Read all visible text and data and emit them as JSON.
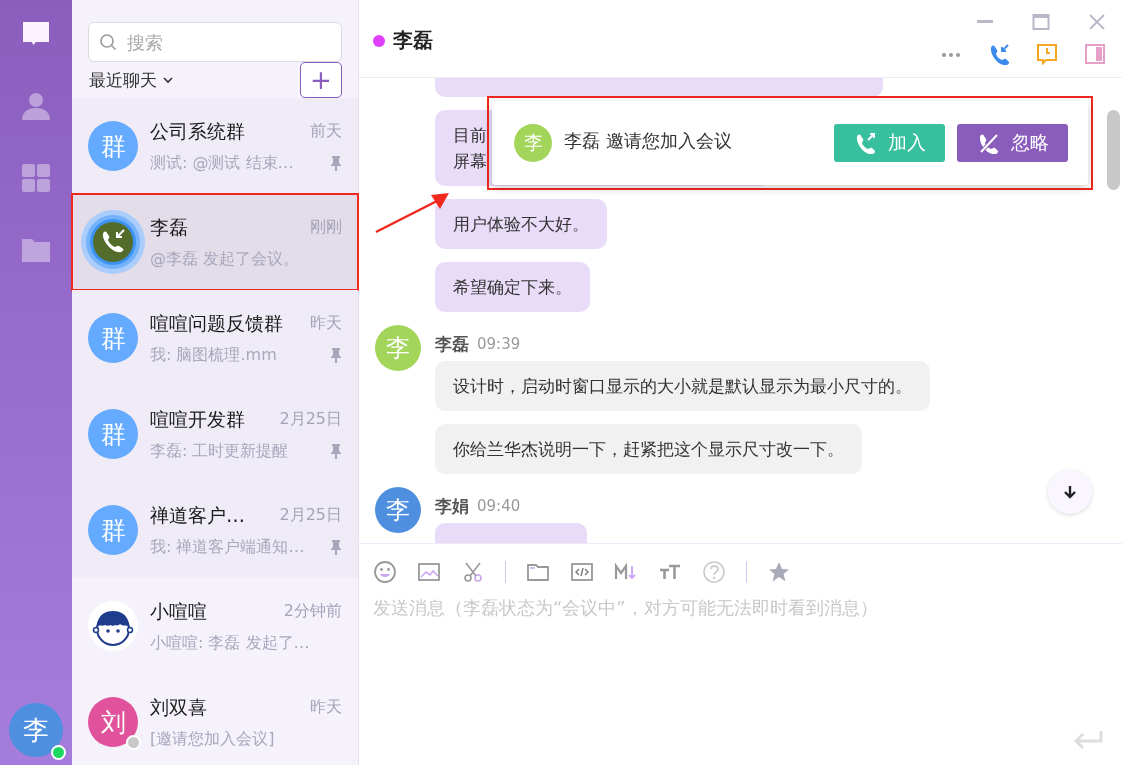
{
  "rail": {
    "items": [
      {
        "kind": "chat",
        "selected": true
      },
      {
        "kind": "contacts",
        "selected": false
      },
      {
        "kind": "apps",
        "selected": false
      },
      {
        "kind": "files",
        "selected": false
      }
    ],
    "user": {
      "avatar": "李",
      "color": "#4f8fe0",
      "online": true
    }
  },
  "search": {
    "placeholder": "搜索"
  },
  "list_header": {
    "label": "最近聊天",
    "add": "+"
  },
  "chats": [
    {
      "name": "公司系统群",
      "time": "前天",
      "preview": "测试: @测试 结束…",
      "kind": "text",
      "avatar": "群",
      "color": "#64aaff",
      "pinned": true,
      "selected": false,
      "annotated": false
    },
    {
      "name": "李磊",
      "time": "刚刚",
      "preview": "@李磊 发起了会议。",
      "kind": "call",
      "pinned": false,
      "selected": true,
      "annotated": true
    },
    {
      "name": "喧喧问题反馈群",
      "time": "昨天",
      "preview": "我: 脑图梳理.mm",
      "kind": "text",
      "avatar": "群",
      "color": "#64aaff",
      "pinned": true,
      "selected": false,
      "annotated": false
    },
    {
      "name": "喧喧开发群",
      "time": "2月25日",
      "preview": "李磊: 工时更新提醒",
      "kind": "text",
      "avatar": "群",
      "color": "#64aaff",
      "pinned": true,
      "selected": false,
      "annotated": false
    },
    {
      "name": "禅道客户…",
      "time": "2月25日",
      "preview": "我: 禅道客户端通知…",
      "kind": "text",
      "avatar": "群",
      "color": "#64aaff",
      "pinned": true,
      "selected": false,
      "annotated": false
    },
    {
      "name": "小喧喧",
      "time": "2分钟前",
      "preview": "小喧喧: 李磊 发起了…",
      "kind": "face",
      "pinned": false,
      "selected": false,
      "annotated": false
    },
    {
      "name": "刘双喜",
      "time": "昨天",
      "preview": "[邀请您加入会议]",
      "kind": "text",
      "avatar": "刘",
      "color": "#e0529c",
      "offline": true,
      "pinned": false,
      "selected": false,
      "annotated": false
    }
  ],
  "conversation": {
    "title": "李磊",
    "color": "#e040fb",
    "window_controls": [
      {
        "kind": "minimize"
      },
      {
        "kind": "maximize"
      },
      {
        "kind": "close"
      }
    ],
    "actions": [
      {
        "kind": "more"
      },
      {
        "kind": "call"
      },
      {
        "kind": "history"
      },
      {
        "kind": "sidebar"
      }
    ],
    "messages": [
      {
        "kind": "cut",
        "own": true
      },
      {
        "kind": "text",
        "own": true,
        "covered": true,
        "lines": [
          "目前",
          "屏幕"
        ]
      },
      {
        "kind": "text",
        "own": true,
        "lines": [
          "用户体验不大好。"
        ]
      },
      {
        "kind": "text",
        "own": true,
        "lines": [
          "希望确定下来。"
        ]
      },
      {
        "kind": "header",
        "name": "李磊",
        "time": "09:39",
        "avatar": "李",
        "color": "#a3d55a"
      },
      {
        "kind": "text",
        "own": false,
        "lines": [
          "设计时，启动时窗口显示的大小就是默认显示为最小尺寸的。"
        ]
      },
      {
        "kind": "text",
        "own": false,
        "lines": [
          "你给兰华杰说明一下，赶紧把这个显示尺寸改一下。"
        ]
      },
      {
        "kind": "header",
        "name": "李娟",
        "time": "09:40",
        "avatar": "李",
        "color": "#4f8fe0"
      },
      {
        "kind": "cut",
        "own": true
      }
    ],
    "invite": {
      "avatar": "李",
      "color": "#a3d55a",
      "text": "李磊 邀请您加入会议",
      "annotated": true,
      "buttons": [
        {
          "kind": "join",
          "label": "加入"
        },
        {
          "kind": "ignore",
          "label": "忽略"
        }
      ]
    },
    "arrow": true,
    "toolbar": [
      {
        "kind": "emoji"
      },
      {
        "kind": "image"
      },
      {
        "kind": "cut"
      },
      {
        "kind": "sep"
      },
      {
        "kind": "folder"
      },
      {
        "kind": "code"
      },
      {
        "kind": "markdown"
      },
      {
        "kind": "font"
      },
      {
        "kind": "help"
      },
      {
        "kind": "sep"
      },
      {
        "kind": "star"
      }
    ],
    "composer": {
      "placeholder": "发送消息（李磊状态为“会议中”，对方可能无法即时看到消息）"
    }
  }
}
